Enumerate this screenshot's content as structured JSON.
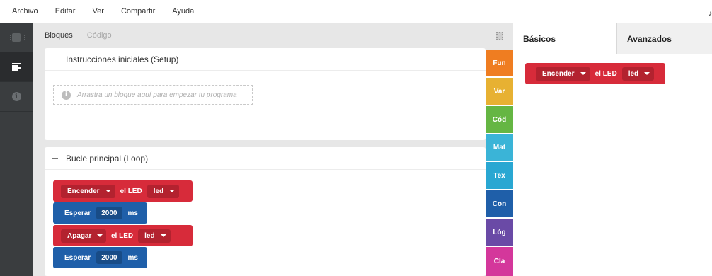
{
  "menubar": {
    "items": [
      "Archivo",
      "Editar",
      "Ver",
      "Compartir",
      "Ayuda"
    ],
    "edge_glyph": "♪"
  },
  "sidebar": {
    "items": [
      {
        "icon": "chip-icon",
        "active": false
      },
      {
        "icon": "blocks-list-icon",
        "active": true
      },
      {
        "icon": "info-icon",
        "active": false
      }
    ]
  },
  "tabs": {
    "bloques": "Bloques",
    "codigo": "Código"
  },
  "setup": {
    "title": "Instrucciones iniciales (Setup)",
    "placeholder": "Arrastra un bloque aquí para empezar tu programa"
  },
  "loop": {
    "title": "Bucle principal (Loop)",
    "blocks": [
      {
        "type": "led",
        "action": "Encender",
        "label": "el LED",
        "target": "led"
      },
      {
        "type": "wait",
        "label": "Esperar",
        "value": "2000",
        "unit": "ms"
      },
      {
        "type": "led",
        "action": "Apagar",
        "label": "el LED",
        "target": "led"
      },
      {
        "type": "wait",
        "label": "Esperar",
        "value": "2000",
        "unit": "ms"
      }
    ]
  },
  "categories": [
    {
      "label": "Fun",
      "color": "#ef7d21"
    },
    {
      "label": "Var",
      "color": "#e7b132"
    },
    {
      "label": "Cód",
      "color": "#65b643"
    },
    {
      "label": "Mat",
      "color": "#3ab4d7"
    },
    {
      "label": "Tex",
      "color": "#29a7d2"
    },
    {
      "label": "Con",
      "color": "#1f5fa9"
    },
    {
      "label": "Lóg",
      "color": "#6a4aa6"
    },
    {
      "label": "Cla",
      "color": "#d4379b"
    }
  ],
  "right_panel": {
    "tabs": [
      "Básicos",
      "Avanzados"
    ],
    "palette_block": {
      "action": "Encender",
      "label": "el LED",
      "target": "led"
    }
  },
  "colors": {
    "led_block": "#d72b3a",
    "wait_block": "#1f5fa9",
    "sidebar": "#3a3d3f",
    "workspace": "#e7e7e7"
  }
}
